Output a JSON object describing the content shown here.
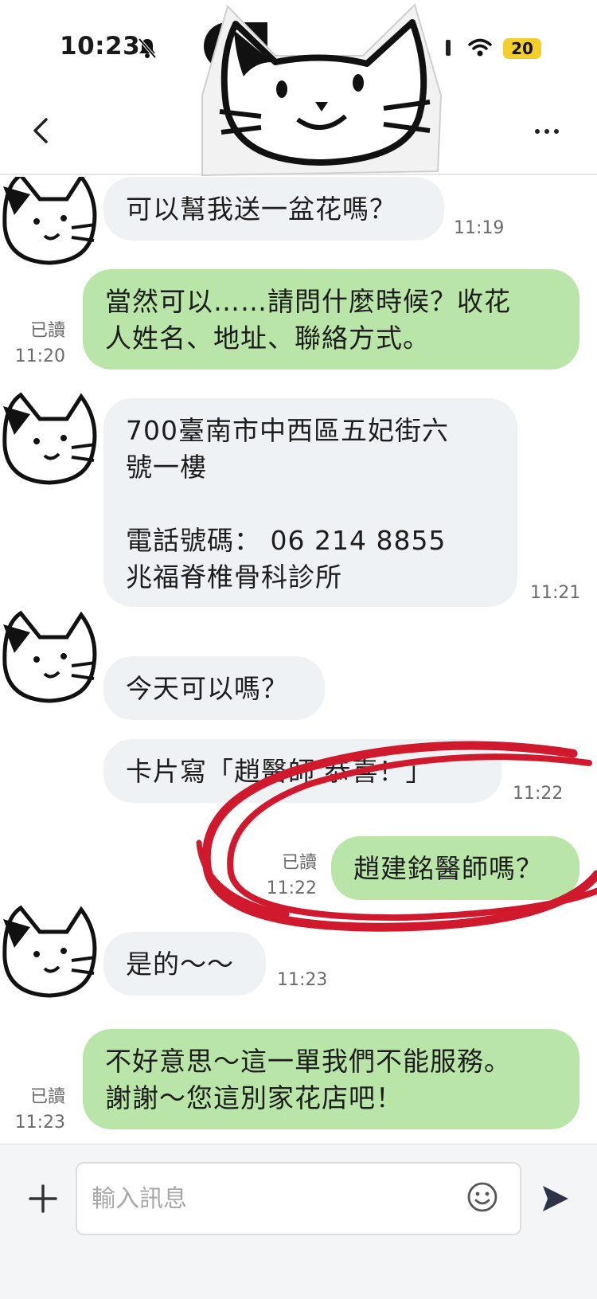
{
  "status_bar": {
    "time": "10:23",
    "battery": "20"
  },
  "header": {
    "back_icon": "chevron-left-icon",
    "more_icon": "more-horizontal-icon"
  },
  "chat": {
    "read_label": "已讀",
    "messages": [
      {
        "side": "in",
        "text": "可以幫我送一盆花嗎？",
        "time": "11:19"
      },
      {
        "side": "out",
        "text": "當然可以……請問什麼時候？收花\n人姓名、地址、聯絡方式。",
        "time": "11:20"
      },
      {
        "side": "in",
        "text": "700臺南市中西區五妃街六\n號一樓\n\n電話號碼： 06 214 8855\n兆福脊椎骨科診所",
        "time": "11:21"
      },
      {
        "side": "in",
        "text": "今天可以嗎？",
        "time": ""
      },
      {
        "side": "in",
        "text": "卡片寫「趙醫師 恭喜！」",
        "time": "11:22"
      },
      {
        "side": "out",
        "text": "趙建銘醫師嗎？",
        "time": "11:22"
      },
      {
        "side": "in",
        "text": "是的～～",
        "time": "11:23"
      },
      {
        "side": "out",
        "text": "不好意思～這一單我們不能服務。\n謝謝～您這別家花店吧！",
        "time": "11:23"
      }
    ]
  },
  "input": {
    "placeholder": "輸入訊息"
  },
  "colors": {
    "outgoing_bubble": "#b9e6a8",
    "incoming_bubble": "#eff2f4",
    "annotation_circle": "#d0192d",
    "battery": "#f3cf2c"
  }
}
